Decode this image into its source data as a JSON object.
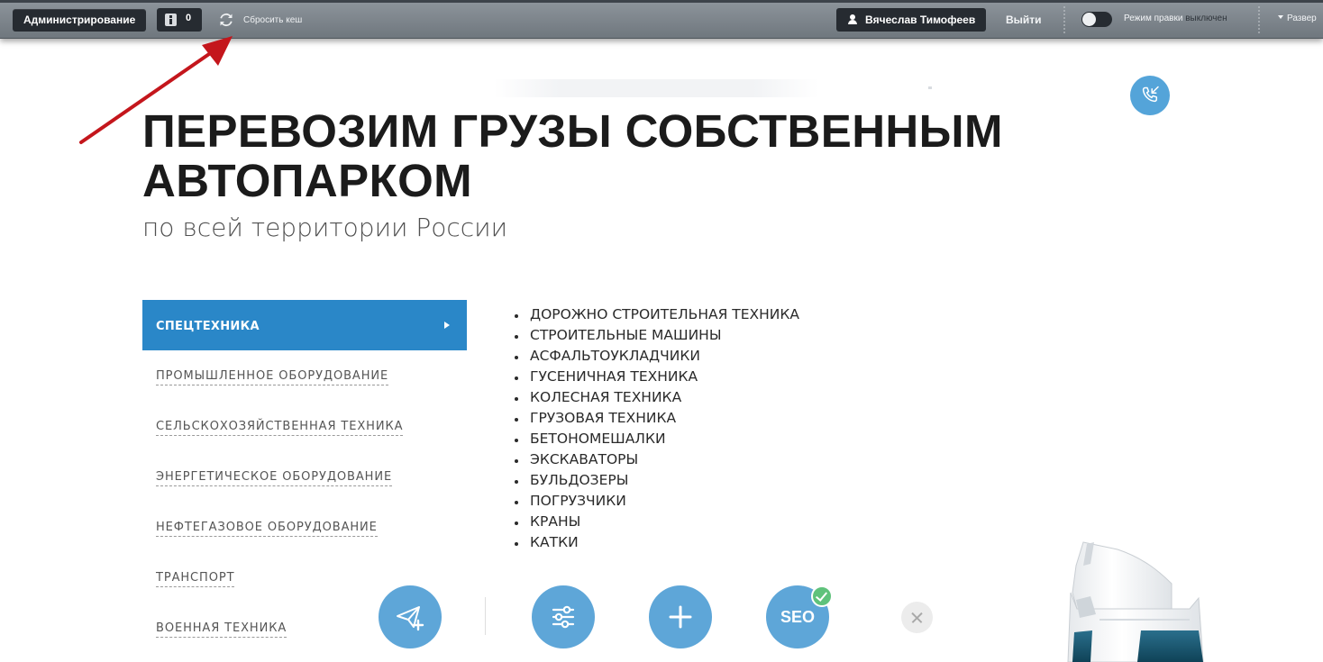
{
  "admin_panel": {
    "admin_label": "Администрирование",
    "notifications_count": "0",
    "clear_cache_label": "Сбросить кеш",
    "user_name": "Вячеслав Тимофеев",
    "logout_label": "Выйти",
    "edit_mode_label": "Режим правки",
    "edit_mode_state": "выключен",
    "expand_label": "Развер"
  },
  "hero": {
    "title_line1": "ПЕРЕВОЗИМ ГРУЗЫ СОБСТВЕННЫМ",
    "title_line2": "АВТОПАРКОМ",
    "subtitle": "по всей территории России"
  },
  "categories": [
    {
      "label": "СПЕЦТЕХНИКА",
      "active": true
    },
    {
      "label": "ПРОМЫШЛЕННОЕ ОБОРУДОВАНИЕ",
      "active": false
    },
    {
      "label": "СЕЛЬСКОХОЗЯЙСТВЕННАЯ ТЕХНИКА",
      "active": false
    },
    {
      "label": "ЭНЕРГЕТИЧЕСКОЕ ОБОРУДОВАНИЕ",
      "active": false
    },
    {
      "label": "НЕФТЕГАЗОВОЕ ОБОРУДОВАНИЕ",
      "active": false
    },
    {
      "label": "ТРАНСПОРТ",
      "active": false
    },
    {
      "label": "ВОЕННАЯ ТЕХНИКА",
      "active": false
    }
  ],
  "subcategories": [
    "ДОРОЖНО СТРОИТЕЛЬНАЯ ТЕХНИКА",
    "СТРОИТЕЛЬНЫЕ МАШИНЫ",
    "АСФАЛЬТОУКЛАДЧИКИ",
    "ГУСЕНИЧНАЯ ТЕХНИКА",
    "КОЛЕСНАЯ ТЕХНИКА",
    "ГРУЗОВАЯ ТЕХНИКА",
    "БЕТОНОМЕШАЛКИ",
    "ЭКСКАВАТОРЫ",
    "БУЛЬДОЗЕРЫ",
    "ПОГРУЗЧИКИ",
    "КРАНЫ",
    "КАТКИ"
  ],
  "toolbar": {
    "seo_label": "SEO"
  },
  "icons": {
    "callback": "phone-callback-icon",
    "send": "paper-plane-add-icon",
    "settings": "sliders-icon",
    "add": "plus-icon",
    "close": "close-icon",
    "refresh": "refresh-icon",
    "user": "user-icon",
    "info": "info-icon"
  },
  "colors": {
    "accent": "#2a87c8",
    "tool_button": "#5ea6d8",
    "admin_bar": "#7f878e",
    "annotation_arrow": "#c4161c",
    "seo_ok": "#5fc27b"
  }
}
